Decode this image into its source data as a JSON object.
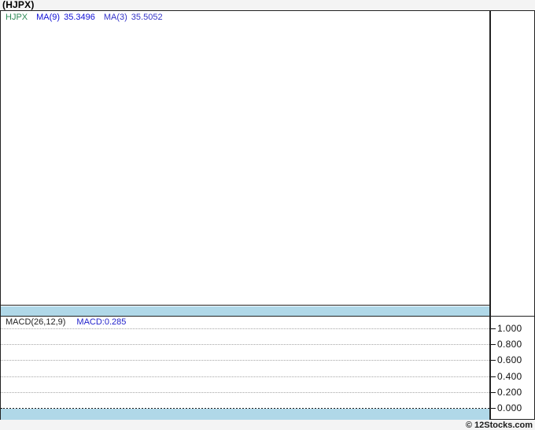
{
  "page": {
    "title": "(HJPX)",
    "footer_credit": "© 12Stocks.com"
  },
  "price_panel": {
    "legend": {
      "symbol": "HJPX",
      "ma9_label": "MA(9)",
      "ma9_value": "35.3496",
      "ma3_label": "MA(3)",
      "ma3_value": "35.5052"
    }
  },
  "macd_panel": {
    "legend": {
      "name": "MACD(26,12,9)",
      "value": "MACD:0.285"
    },
    "axis_ticks": [
      "1.000",
      "0.800",
      "0.600",
      "0.400",
      "0.200",
      "0.000"
    ]
  },
  "colors": {
    "symbol_text": "#2e8b57",
    "ma9_text": "#0f0fd6",
    "ma3_text": "#3434c8",
    "macd_value_text": "#2222cc",
    "separator_band": "#b0d8e8",
    "frame_border": "#222222",
    "background": "#f4f4f4"
  },
  "chart_data": {
    "type": "line",
    "title": "(HJPX)",
    "panels": [
      {
        "name": "price",
        "series": [
          {
            "name": "HJPX",
            "values": []
          },
          {
            "name": "MA(9)",
            "current_value": 35.3496,
            "values": []
          },
          {
            "name": "MA(3)",
            "current_value": 35.5052,
            "values": []
          }
        ],
        "note": "plot area is empty (no visible price data)"
      },
      {
        "name": "MACD(26,12,9)",
        "current_value": 0.285,
        "values": [],
        "ylim": [
          0.0,
          1.0
        ],
        "yticks": [
          1.0,
          0.8,
          0.6,
          0.4,
          0.2,
          0.0
        ],
        "grid": true,
        "legend_position": "top-left",
        "axis_position": "right"
      }
    ]
  }
}
